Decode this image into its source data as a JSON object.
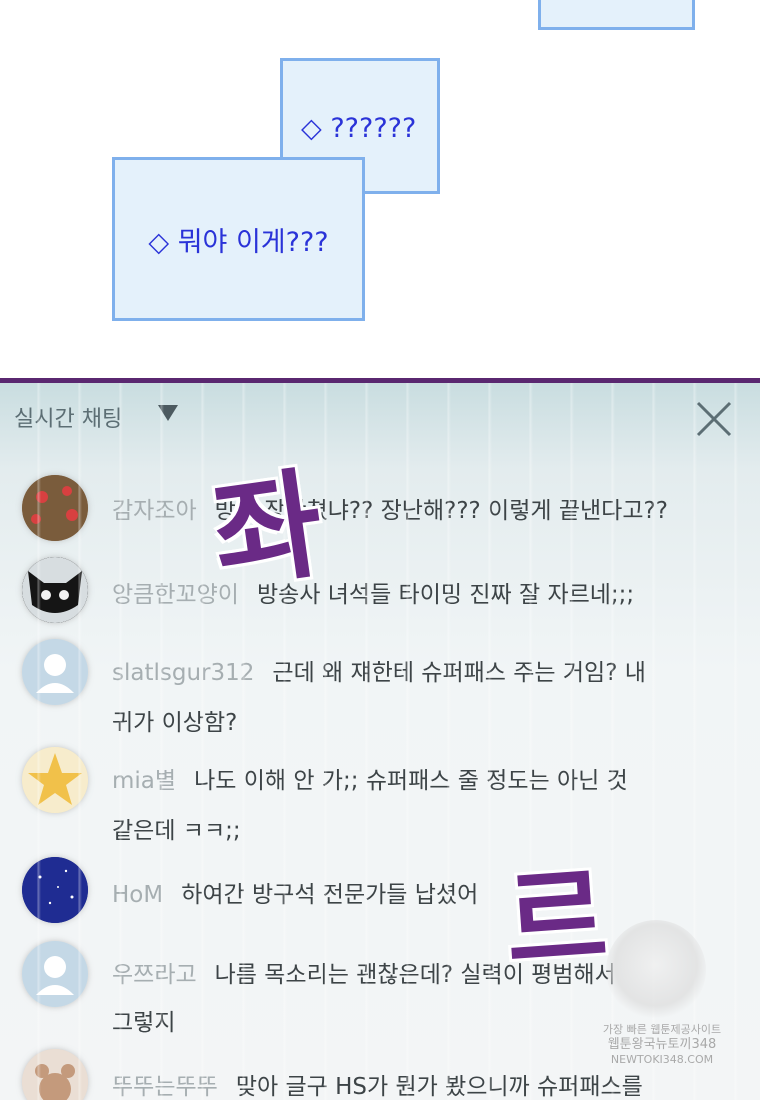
{
  "bubbles": {
    "top": "",
    "middle": "◇ ??????",
    "lower": "◇ 뭐야 이게???"
  },
  "chat": {
    "title": "실시간 채팅",
    "messages": [
      {
        "nick": "감자조아",
        "text": "방송 장난쳤냐?? 장난해??? 이렇게 끝낸다고??",
        "cont": ""
      },
      {
        "nick": "앙큼한꼬양이",
        "text": "방송사 녀석들 타이밍 진짜 잘 자르네;;;",
        "cont": ""
      },
      {
        "nick": "slatlsgur312",
        "text": "근데 왜 쟤한테 슈퍼패스 주는 거임? 내",
        "cont": "귀가 이상함?"
      },
      {
        "nick": "mia별",
        "text": "나도 이해 안 가;; 슈퍼패스 줄 정도는 아닌 것",
        "cont": "같은데 ㅋㅋ;;"
      },
      {
        "nick": "HoM",
        "text": "하여간 방구석 전문가들 납셨어",
        "cont": ""
      },
      {
        "nick": "우쯔라고",
        "text": "나름 목소리는 괜찮은데? 실력이 평범해서",
        "cont": "그렇지"
      },
      {
        "nick": "뚜뚜는뚜뚜",
        "text": "맞아 글구 HS가 뭔가 봤으니까 슈퍼패스를",
        "cont": ""
      }
    ]
  },
  "sfx": {
    "first": "좌",
    "second": "르"
  },
  "watermark": {
    "line1": "가장 빠른 웹툰제공사이트",
    "line2": "웹툰왕국뉴토끼348",
    "line3": "NEWTOKI348.COM"
  },
  "colors": {
    "panel_border": "#5a2770",
    "bubble_text": "#2a33d8",
    "bubble_border": "#7fb0ec",
    "sfx": "#6a2a86"
  }
}
